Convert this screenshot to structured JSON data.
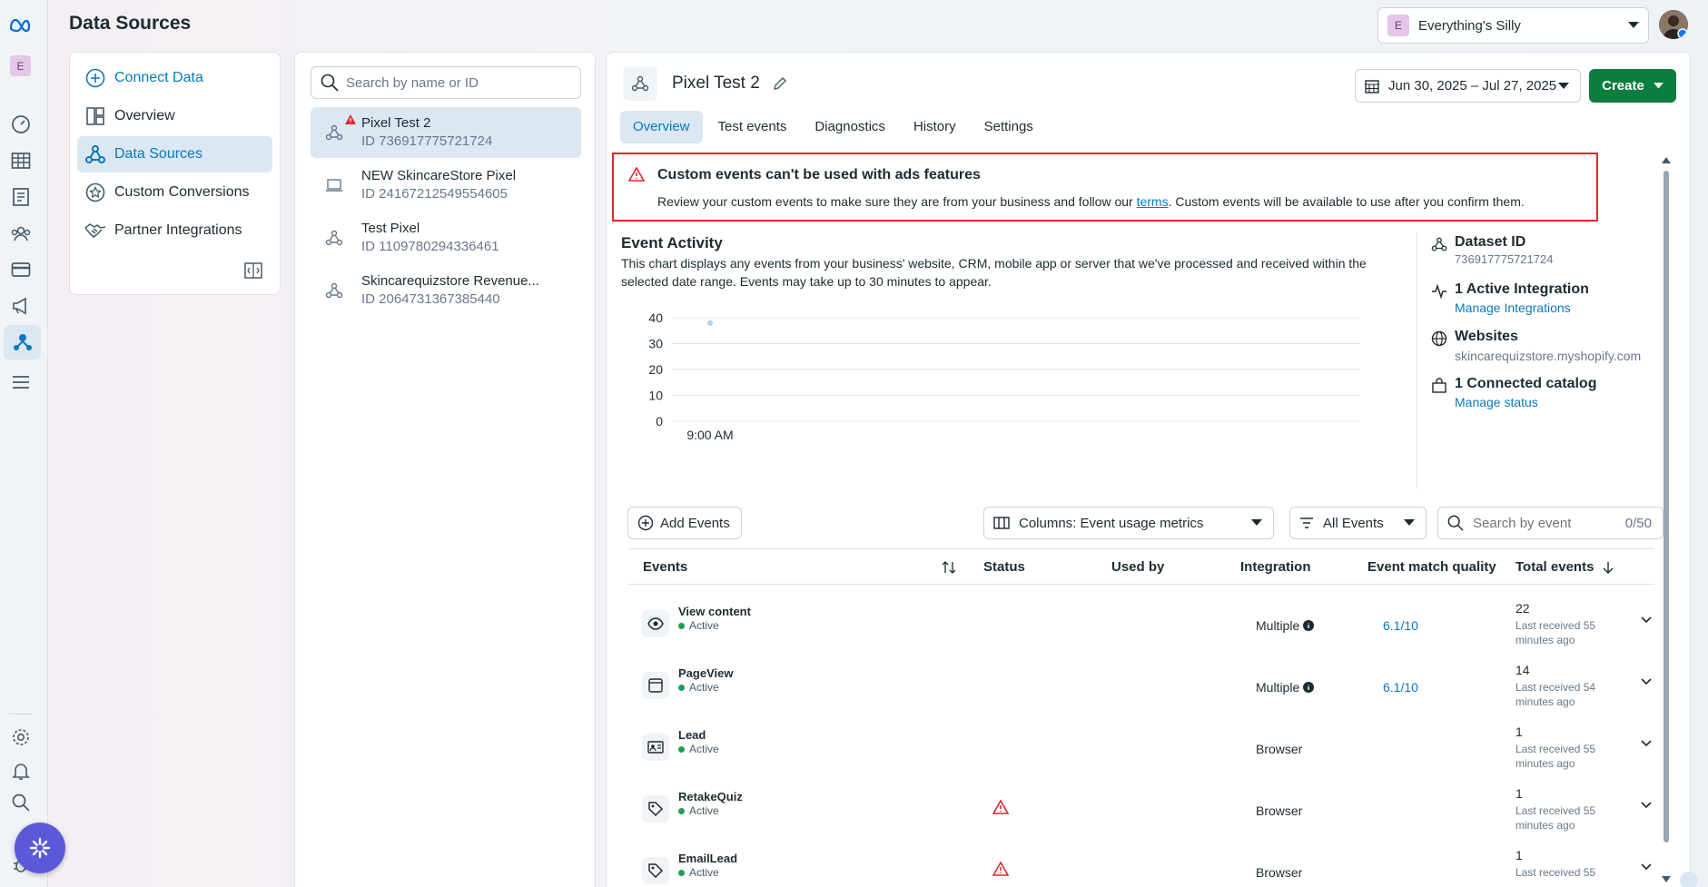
{
  "header": {
    "title": "Data Sources",
    "account_name": "Everything's Silly",
    "account_initial": "E"
  },
  "rail": {
    "workspace_initial": "E"
  },
  "nav": {
    "items": [
      {
        "label": "Connect Data"
      },
      {
        "label": "Overview"
      },
      {
        "label": "Data Sources"
      },
      {
        "label": "Custom Conversions"
      },
      {
        "label": "Partner Integrations"
      }
    ]
  },
  "source_list": {
    "search_placeholder": "Search by name or ID",
    "items": [
      {
        "name": "Pixel Test 2",
        "id": "ID 736917775721724"
      },
      {
        "name": "NEW SkincareStore Pixel",
        "id": "ID 24167212549554605"
      },
      {
        "name": "Test Pixel",
        "id": "ID 1109780294336461"
      },
      {
        "name": "Skincarequizstore Revenue...",
        "id": "ID 2064731367385440"
      }
    ]
  },
  "dataset": {
    "title": "Pixel Test 2",
    "date_range": "Jun 30, 2025 – Jul 27, 2025",
    "create_label": "Create"
  },
  "tabs": [
    {
      "label": "Overview"
    },
    {
      "label": "Test events"
    },
    {
      "label": "Diagnostics"
    },
    {
      "label": "History"
    },
    {
      "label": "Settings"
    }
  ],
  "alert": {
    "title": "Custom events can't be used with ads features",
    "body_before": "Review your custom events to make sure they are from your business and follow our ",
    "link": "terms",
    "body_after": ". Custom events will be available to use after you confirm them."
  },
  "activity": {
    "title": "Event Activity",
    "description": "This chart displays any events from your business' website, CRM, mobile app or server that we've processed and received within the selected date range. Events may take up to 30 minutes to appear."
  },
  "chart_data": {
    "type": "scatter",
    "x": [
      "9:00 AM"
    ],
    "series": [
      {
        "values": [
          38
        ]
      }
    ],
    "ylim": [
      0,
      40
    ],
    "yticks": [
      0,
      10,
      20,
      30,
      40
    ],
    "xlabel": "",
    "ylabel": "",
    "grid": true,
    "color": "#a8d4f5"
  },
  "info": {
    "dataset_id_label": "Dataset ID",
    "dataset_id": "736917775721724",
    "integration_label": "1 Active Integration",
    "integration_link": "Manage Integrations",
    "websites_label": "Websites",
    "website": "skincarequizstore.myshopify.com",
    "catalog_label": "1 Connected catalog",
    "catalog_link": "Manage status"
  },
  "toolbar": {
    "add_events": "Add Events",
    "columns": "Columns: Event usage metrics",
    "filter": "All Events",
    "search_placeholder": "Search by event",
    "search_count": "0/50"
  },
  "table": {
    "headers": {
      "events": "Events",
      "status": "Status",
      "used_by": "Used by",
      "integration": "Integration",
      "emq": "Event match quality",
      "total": "Total events"
    },
    "rows": [
      {
        "name": "View content",
        "status": "Active",
        "warning": false,
        "integration": "Multiple",
        "info": true,
        "emq": "6.1/10",
        "total": "22",
        "last": "Last received 55 minutes ago",
        "icon": "eye-icon"
      },
      {
        "name": "PageView",
        "status": "Active",
        "warning": false,
        "integration": "Multiple",
        "info": true,
        "emq": "6.1/10",
        "total": "14",
        "last": "Last received 54 minutes ago",
        "icon": "page-icon"
      },
      {
        "name": "Lead",
        "status": "Active",
        "warning": false,
        "integration": "Browser",
        "info": false,
        "emq": "",
        "total": "1",
        "last": "Last received 55 minutes ago",
        "icon": "id-card-icon"
      },
      {
        "name": "RetakeQuiz",
        "status": "Active",
        "warning": true,
        "integration": "Browser",
        "info": false,
        "emq": "",
        "total": "1",
        "last": "Last received 55 minutes ago",
        "icon": "tag-icon"
      },
      {
        "name": "EmailLead",
        "status": "Active",
        "warning": true,
        "integration": "Browser",
        "info": false,
        "emq": "",
        "total": "1",
        "last": "Last received 55",
        "icon": "tag-icon"
      }
    ]
  }
}
